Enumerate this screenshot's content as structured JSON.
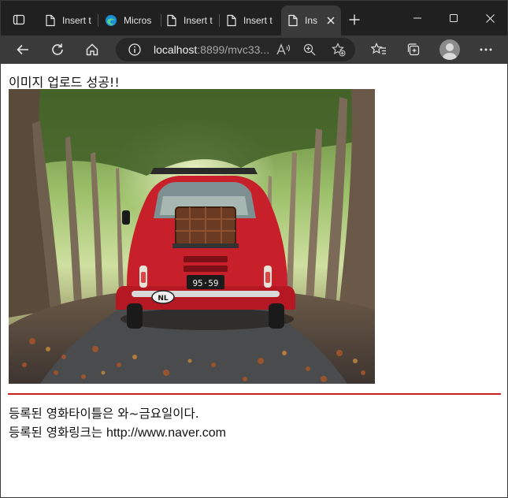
{
  "browser": {
    "tabs": [
      {
        "label": "Insert t",
        "icon": "page-icon"
      },
      {
        "label": "Micros",
        "icon": "edge-icon"
      },
      {
        "label": "Insert t",
        "icon": "page-icon"
      },
      {
        "label": "Insert t",
        "icon": "page-icon"
      },
      {
        "label": "Ins",
        "icon": "page-icon",
        "active": true
      }
    ],
    "address": {
      "host": "localhost",
      "rest": ":8899/mvc33..."
    }
  },
  "page": {
    "heading": "이미지 업로드 성공!!",
    "image_alt": "red car on leaf-covered road",
    "title_line": "등록된 영화타이틀은 와~금요일이다.",
    "link_prefix": "등록된 영화링크는 ",
    "link_url": "http://www.naver.com"
  },
  "colors": {
    "tabstrip": "#202020",
    "toolbar": "#3a3a3a",
    "rule": "#cc1f1f"
  }
}
